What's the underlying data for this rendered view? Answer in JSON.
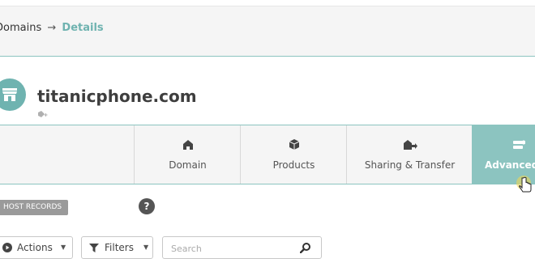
{
  "breadcrumb": {
    "root": "Domains",
    "separator": "→",
    "current": "Details"
  },
  "domain": {
    "name": "titanicphone.com"
  },
  "tabs": [
    {
      "label": "Domain",
      "icon": "home-icon"
    },
    {
      "label": "Products",
      "icon": "box-icon"
    },
    {
      "label": "Sharing & Transfer",
      "icon": "share-house-icon"
    },
    {
      "label": "Advanced",
      "icon": "server-icon",
      "active": true
    }
  ],
  "section": {
    "label": "HOST RECORDS",
    "help": "?"
  },
  "toolbar": {
    "actions_label": "Actions",
    "filters_label": "Filters",
    "search_placeholder": "Search"
  },
  "colors": {
    "accent": "#8cc4c0",
    "link": "#6fb3b0"
  }
}
